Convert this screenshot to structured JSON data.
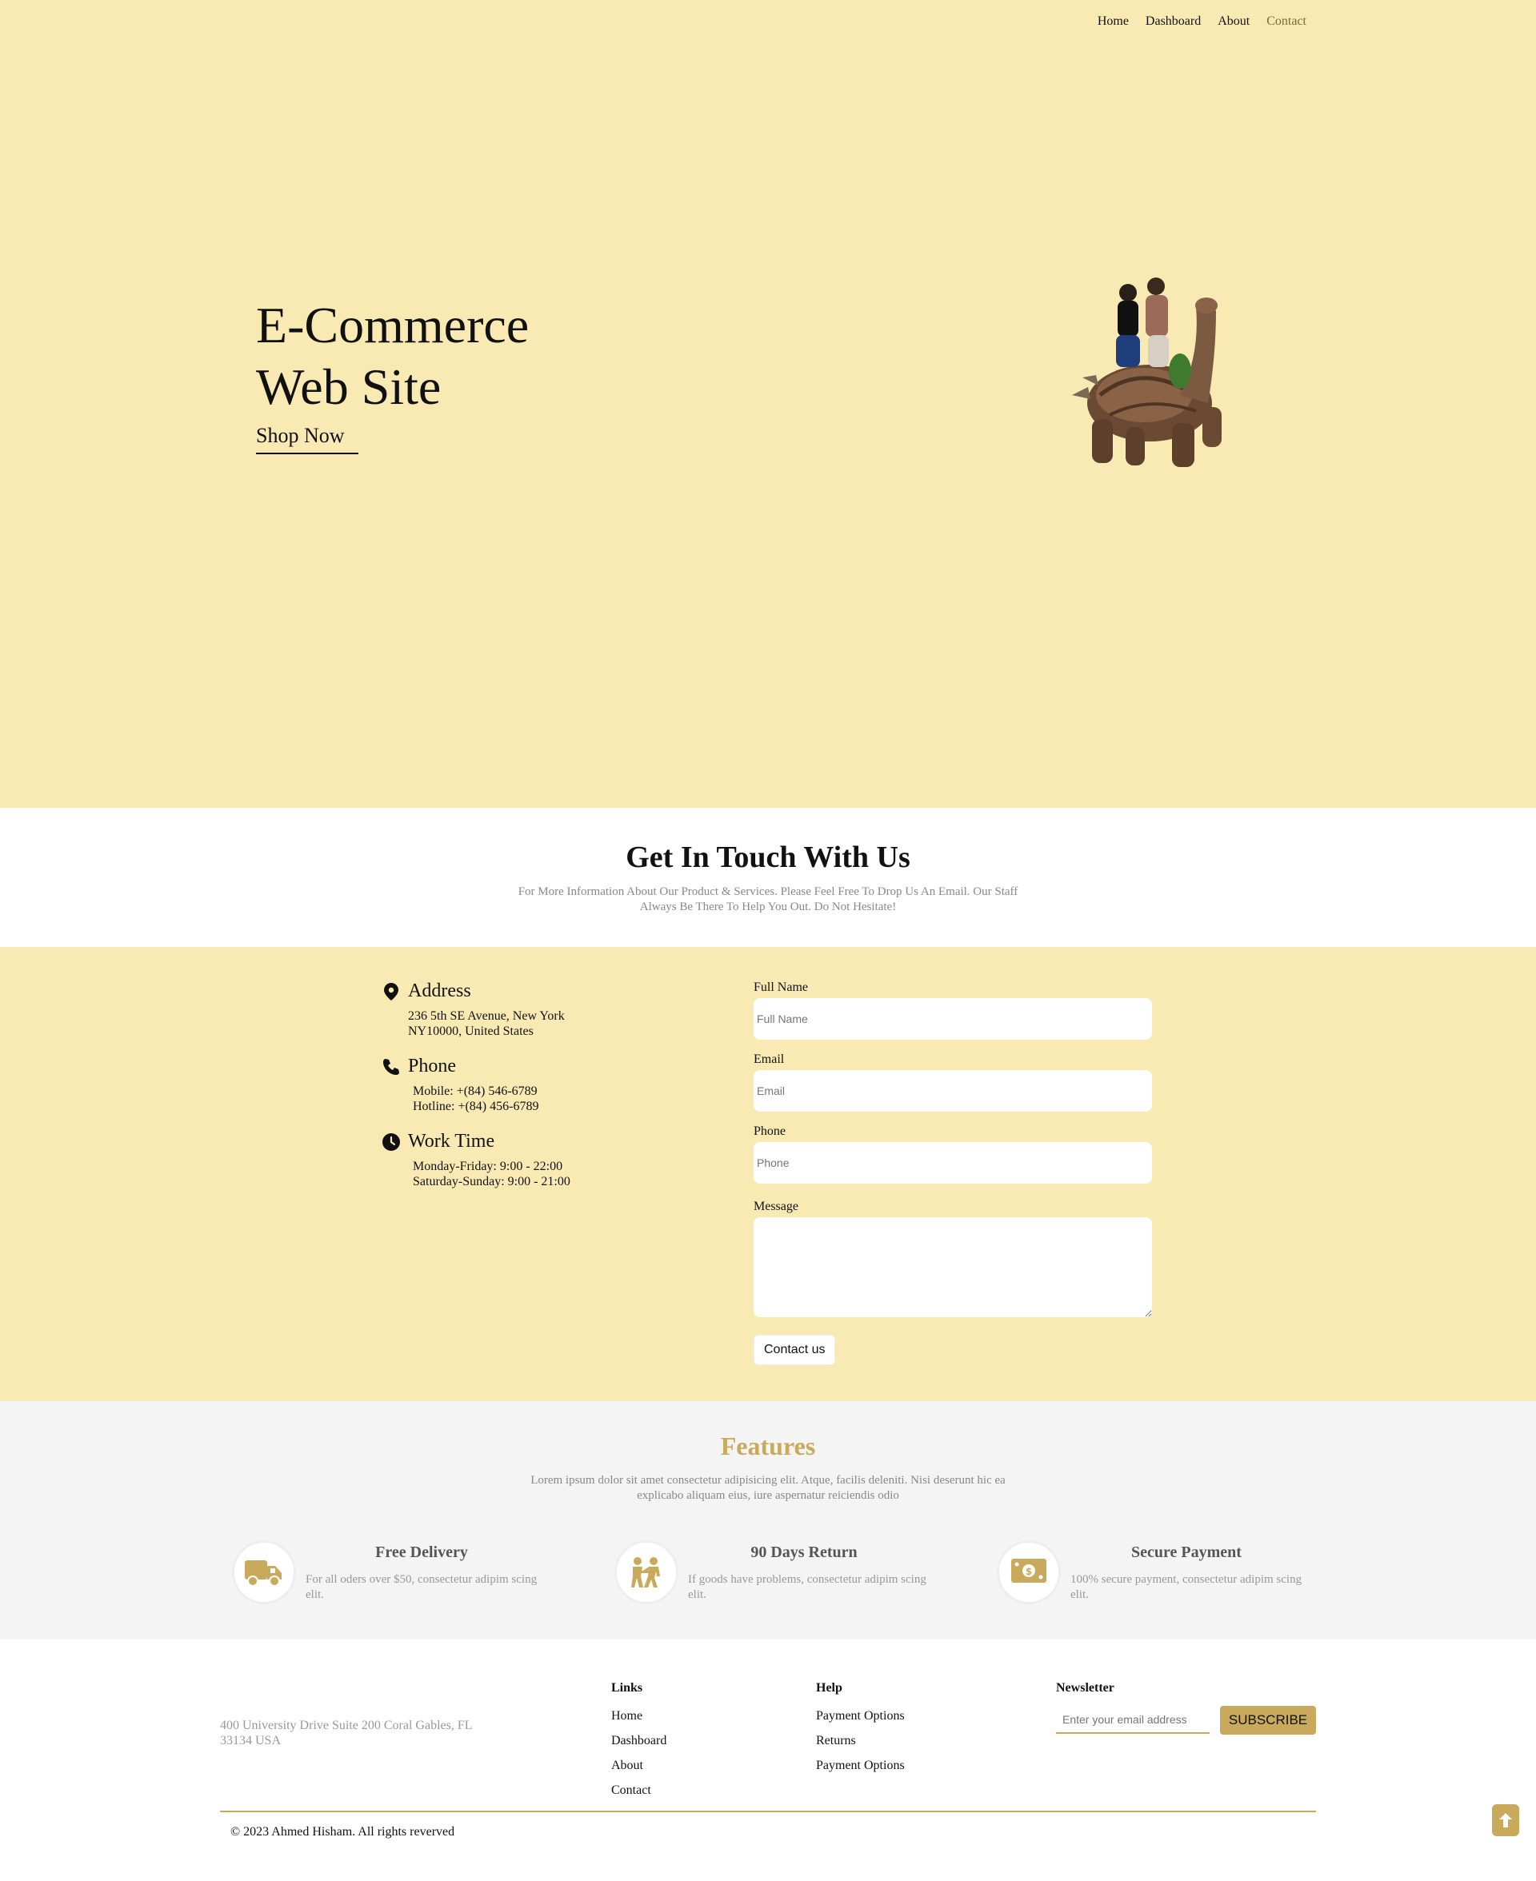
{
  "nav": {
    "items": [
      "Home",
      "Dashboard",
      "About",
      "Contact"
    ],
    "active": "Contact"
  },
  "hero": {
    "title_line1": "E-Commerce",
    "title_line2": "Web Site",
    "cta": "Shop Now"
  },
  "touch": {
    "title": "Get In Touch With Us",
    "subtitle": "For More Information About Our Product & Services. Please Feel Free To Drop Us An Email. Our Staff Always Be There To Help You Out. Do Not Hesitate!"
  },
  "contact": {
    "address": {
      "label": "Address",
      "lines": [
        "236 5th SE Avenue, New York",
        "NY10000, United States"
      ],
      "icon": "map-pin-icon"
    },
    "phone": {
      "label": "Phone",
      "lines": [
        "Mobile: +(84) 546-6789",
        "Hotline: +(84) 456-6789"
      ],
      "icon": "phone-icon"
    },
    "work_time": {
      "label": "Work Time",
      "lines": [
        "Monday-Friday: 9:00 - 22:00",
        "Saturday-Sunday: 9:00 - 21:00"
      ],
      "icon": "clock-icon"
    },
    "form": {
      "full_name_label": "Full Name",
      "full_name_placeholder": "Full Name",
      "email_label": "Email",
      "email_placeholder": "Email",
      "phone_label": "Phone",
      "phone_placeholder": "Phone",
      "message_label": "Message",
      "submit": "Contact us"
    }
  },
  "features": {
    "title": "Features",
    "subtitle": "Lorem ipsum dolor sit amet consectetur adipisicing elit. Atque, facilis deleniti. Nisi deserunt hic ea explicabo aliquam eius, iure aspernatur reiciendis odio",
    "items": [
      {
        "title": "Free Delivery",
        "desc": "For all oders over $50, consectetur adipim scing elit.",
        "icon": "truck-icon"
      },
      {
        "title": "90 Days Return",
        "desc": "If goods have problems, consectetur adipim scing elit.",
        "icon": "return-people-icon"
      },
      {
        "title": "Secure Payment",
        "desc": "100% secure payment, consectetur adipim scing elit.",
        "icon": "money-icon"
      }
    ]
  },
  "footer": {
    "address": "400 University Drive Suite 200 Coral Gables, FL 33134 USA",
    "links_title": "Links",
    "links": [
      "Home",
      "Dashboard",
      "About",
      "Contact"
    ],
    "help_title": "Help",
    "help": [
      "Payment Options",
      "Returns",
      "Payment Options"
    ],
    "newsletter_title": "Newsletter",
    "newsletter_placeholder": "Enter your email address",
    "subscribe": "SUBSCRIBE",
    "copyright": "© 2023 Ahmed Hisham. All rights reverved"
  },
  "colors": {
    "hero_bg": "#f9eab4",
    "accent": "#c9a95b",
    "features_bg": "#f4f4f4"
  }
}
